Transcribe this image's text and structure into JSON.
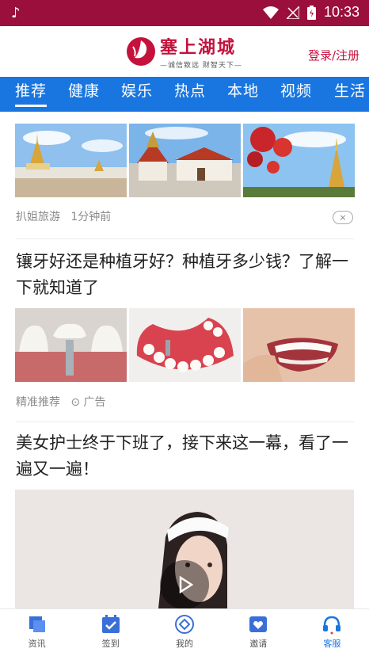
{
  "status_bar": {
    "time": "10:33"
  },
  "header": {
    "logo_title": "塞上湖城",
    "logo_slogan": "—诚信致远 财智天下—",
    "login_link": "登录/注册",
    "brand_color": "#c4123c"
  },
  "tabs": [
    {
      "label": "推荐",
      "active": true
    },
    {
      "label": "健康"
    },
    {
      "label": "娱乐"
    },
    {
      "label": "热点"
    },
    {
      "label": "本地"
    },
    {
      "label": "视频"
    },
    {
      "label": "生活"
    }
  ],
  "feed": {
    "article1": {
      "source": "扒姐旅游",
      "time": "1分钟前",
      "close_label": "×"
    },
    "article2": {
      "title": "镶牙好还是种植牙好？种植牙多少钱？了解一下就知道了",
      "source": "精准推荐",
      "ad_label": "广告"
    },
    "article3": {
      "title": "美女护士终于下班了，接下来这一幕，看了一遍又一遍！"
    }
  },
  "bottom_nav": [
    {
      "label": "资讯",
      "icon": "news-icon"
    },
    {
      "label": "签到",
      "icon": "checkin-icon"
    },
    {
      "label": "我的",
      "icon": "profile-icon"
    },
    {
      "label": "邀请",
      "icon": "invite-icon"
    },
    {
      "label": "客服",
      "icon": "headset-icon",
      "active": true
    }
  ],
  "accent_color": "#1976e1"
}
